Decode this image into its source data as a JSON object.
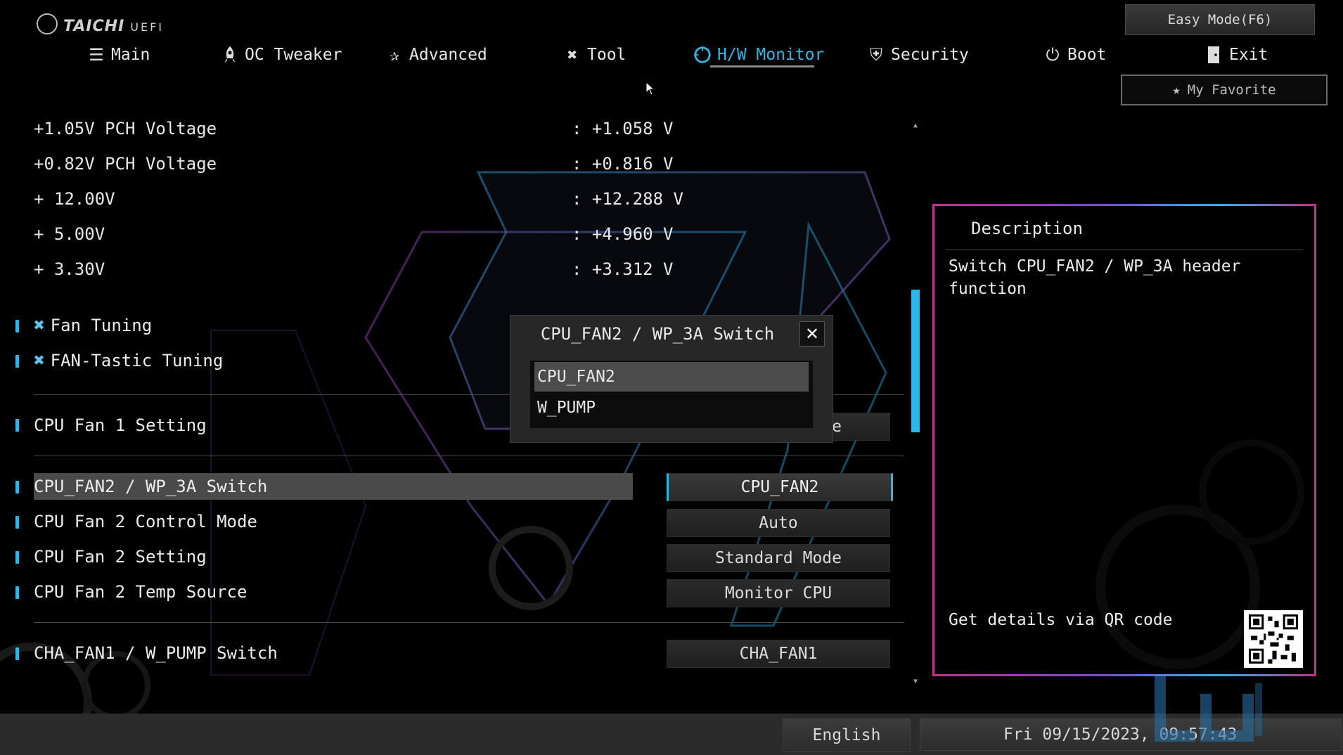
{
  "header": {
    "brand": "TAICHI",
    "brand_sub": "UEFI",
    "easy_mode_label": "Easy Mode(F6)",
    "favorite_label": "My Favorite"
  },
  "nav": {
    "tabs": [
      {
        "label": "Main",
        "icon": "list-icon"
      },
      {
        "label": "OC Tweaker",
        "icon": "rocket-icon"
      },
      {
        "label": "Advanced",
        "icon": "star-icon"
      },
      {
        "label": "Tool",
        "icon": "tools-icon"
      },
      {
        "label": "H/W Monitor",
        "icon": "monitor-gauge-icon",
        "active": true
      },
      {
        "label": "Security",
        "icon": "shield-icon"
      },
      {
        "label": "Boot",
        "icon": "power-icon"
      },
      {
        "label": "Exit",
        "icon": "exit-door-icon"
      }
    ]
  },
  "voltages": [
    {
      "label": "+1.05V PCH Voltage",
      "value": ": +1.058 V"
    },
    {
      "label": "+0.82V PCH Voltage",
      "value": ": +0.816 V"
    },
    {
      "label": "+ 12.00V",
      "value": ": +12.288 V"
    },
    {
      "label": "+ 5.00V",
      "value": ": +4.960 V"
    },
    {
      "label": "+ 3.30V",
      "value": ": +3.312 V"
    }
  ],
  "menu": {
    "fan_tuning": "Fan Tuning",
    "fantastic_tuning": "FAN-Tastic Tuning",
    "cpu_fan1_setting": "CPU Fan 1 Setting",
    "cpu_fan1_setting_value": "Standard Mode",
    "cpu_fan2_switch": "CPU_FAN2 / WP_3A Switch",
    "cpu_fan2_switch_value": "CPU_FAN2",
    "cpu_fan2_control": "CPU Fan 2 Control Mode",
    "cpu_fan2_control_value": "Auto",
    "cpu_fan2_setting": "CPU Fan 2 Setting",
    "cpu_fan2_setting_value": "Standard Mode",
    "cpu_fan2_temp": "CPU Fan 2 Temp Source",
    "cpu_fan2_temp_value": "Monitor CPU",
    "cha_fan1_switch": "CHA_FAN1 / W_PUMP Switch",
    "cha_fan1_switch_value": "CHA_FAN1"
  },
  "modal": {
    "title": "CPU_FAN2 / WP_3A Switch",
    "options": [
      "CPU_FAN2",
      "W_PUMP"
    ],
    "selected_index": 0
  },
  "description": {
    "title": "Description",
    "text": "Switch CPU_FAN2 / WP_3A header function",
    "qr_text": "Get details via QR code"
  },
  "footer": {
    "language": "English",
    "datetime": "Fri 09/15/2023, 09:57:43"
  },
  "colors": {
    "accent": "#2fb7e8",
    "background": "#000000",
    "panel_border_pink": "#c0338c",
    "panel_border_purple": "#7a4bd8"
  }
}
